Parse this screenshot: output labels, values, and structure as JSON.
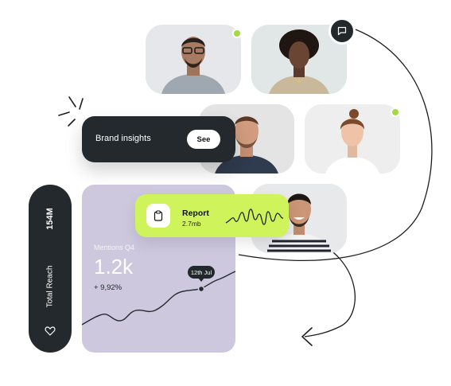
{
  "colors": {
    "dark": "#23292c",
    "lime": "#cff35b",
    "lavender": "#cdc8de",
    "online": "#a4d93f"
  },
  "people": [
    {
      "name": "person-glasses-man",
      "online": true
    },
    {
      "name": "person-curly-woman",
      "online": false
    },
    {
      "name": "person-bearded-man",
      "online": false
    },
    {
      "name": "person-woman-bun",
      "online": true
    },
    {
      "name": "person-smiling-man-striped",
      "online": false
    }
  ],
  "icons": {
    "chat": "chat-bubble-icon",
    "reach": "heart-icon",
    "report": "clipboard-icon"
  },
  "brand": {
    "label": "Brand insights",
    "button": "See"
  },
  "reach": {
    "value": "154M",
    "label": "Total Reach"
  },
  "mentions": {
    "label": "Mentions Q4",
    "value": "1.2k",
    "change": "+ 9,92%",
    "tooltip": "12th Jul"
  },
  "report": {
    "title": "Report",
    "size": "2.7mb"
  }
}
